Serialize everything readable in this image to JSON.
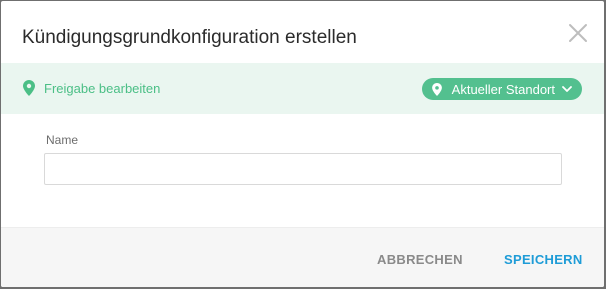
{
  "dialog": {
    "title": "Kündigungsgrundkonfiguration erstellen"
  },
  "banner": {
    "link_label": "Freigabe bearbeiten",
    "location_label": "Aktueller Standort"
  },
  "form": {
    "name_label": "Name",
    "name_value": "",
    "name_placeholder": ""
  },
  "footer": {
    "cancel_label": "ABBRECHEN",
    "save_label": "SPEICHERN"
  },
  "colors": {
    "accent_green": "#53c08f",
    "banner_bg": "#eaf6f0",
    "save_blue": "#1e9cd7"
  }
}
